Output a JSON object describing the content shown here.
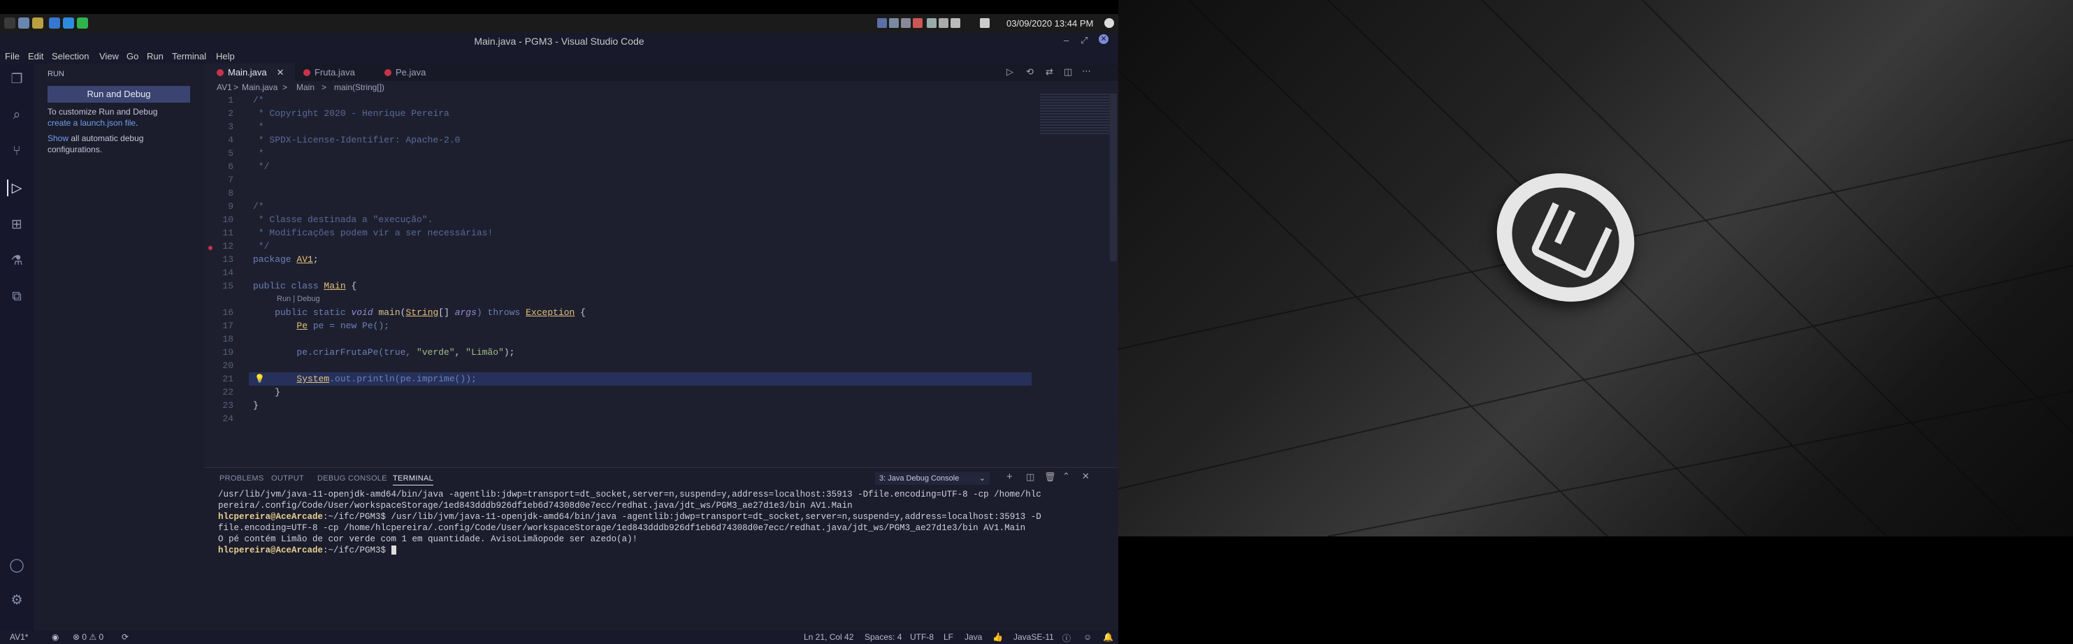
{
  "taskbar": {
    "clock": "03/09/2020 13:44 PM"
  },
  "window": {
    "title": "Main.java - PGM3 - Visual Studio Code"
  },
  "menubar": {
    "items": [
      "File",
      "Edit",
      "Selection",
      "View",
      "Go",
      "Run",
      "Terminal",
      "Help"
    ]
  },
  "sidebar": {
    "header": "RUN",
    "run_button": "Run and Debug",
    "customize_text": "To customize Run and Debug",
    "launch_link": "create a launch.json file",
    "launch_suffix": ".",
    "show_link": "Show",
    "show_text": " all automatic debug",
    "show_text2": "configurations."
  },
  "tabs": [
    {
      "label": "Main.java",
      "active": true
    },
    {
      "label": "Fruta.java",
      "active": false
    },
    {
      "label": "Pe.java",
      "active": false
    }
  ],
  "breadcrumb": {
    "project": "AV1",
    "file": "Main.java",
    "cls": "Main",
    "method": "main(String[])",
    "sep": ">"
  },
  "code": {
    "line_numbers": [
      "1",
      "2",
      "3",
      "4",
      "5",
      "6",
      "7",
      "8",
      "9",
      "10",
      "11",
      "12",
      "13",
      "14",
      "15",
      "",
      "16",
      "17",
      "18",
      "19",
      "20",
      "21",
      "22",
      "23",
      "24"
    ],
    "l1": "/*",
    "l2": " * Copyright 2020 - Henrique Pereira",
    "l3": " *",
    "l4": " * SPDX-License-Identifier: Apache-2.0",
    "l5": " *",
    "l6": " */",
    "l9": "/*",
    "l10": " * Classe destinada a \"execução\".",
    "l11": " * Modificações podem vir a ser necessárias!",
    "l12": " */",
    "l13a": "package ",
    "l13b": "AV1",
    "l13c": ";",
    "l15a": "public class ",
    "l15b": "Main",
    "l15c": " {",
    "codelens": "Run | Debug",
    "l16a": "    public static ",
    "l16b": "void ",
    "l16c": "main",
    "l16d": "(",
    "l16e": "String",
    "l16f": "[] ",
    "l16g": "args",
    "l16h": ") throws ",
    "l16i": "Exception",
    "l16j": " {",
    "l17a": "        ",
    "l17b": "Pe",
    "l17c": " pe = new Pe();",
    "l19a": "        pe.criarFrutaPe(true, ",
    "l19b": "\"verde\"",
    "l19c": ", ",
    "l19d": "\"Limão\"",
    "l19e": ");",
    "l21a": "        ",
    "l21b": "System",
    "l21c": ".out.println(pe.imprime());",
    "l22": "    }",
    "l23": "}"
  },
  "panel": {
    "tabs": [
      "PROBLEMS",
      "OUTPUT",
      "DEBUG CONSOLE",
      "TERMINAL"
    ],
    "dropdown": "3: Java Debug Console",
    "term": {
      "l1": " /usr/lib/jvm/java-11-openjdk-amd64/bin/java -agentlib:jdwp=transport=dt_socket,server=n,suspend=y,address=localhost:35913 -Dfile.encoding=UTF-8 -cp /home/hlc",
      "l2": "pereira/.config/Code/User/workspaceStorage/1ed843dddb926df1eb6d74308d0e7ecc/redhat.java/jdt_ws/PGM3_ae27d1e3/bin AV1.Main",
      "l3p": "hlcpereira@AceArcade",
      "l3a": ":~/ifc/PGM3$  /usr/lib/jvm/java-11-openjdk-amd64/bin/java -agentlib:jdwp=transport=dt_socket,server=n,suspend=y,address=localhost:35913 -D",
      "l4": "file.encoding=UTF-8 -cp /home/hlcpereira/.config/Code/User/workspaceStorage/1ed843dddb926df1eb6d74308d0e7ecc/redhat.java/jdt_ws/PGM3_ae27d1e3/bin AV1.Main",
      "l5": "O pé contém Limão de cor verde com 1 em quantidade. AvisoLimãopode ser azedo(a)!",
      "l6p": "hlcpereira@AceArcade",
      "l6a": ":~/ifc/PGM3$ "
    }
  },
  "statusbar": {
    "branch": "AV1*",
    "problems": "⊗ 0 ⚠ 0",
    "cursor": "Ln 21, Col 42",
    "spaces": "Spaces: 4",
    "encoding": "UTF-8",
    "eol": "LF",
    "language": "Java",
    "jdk": "JavaSE-11"
  },
  "colors": {
    "accent": "#3c4a7a",
    "run_button": "#3b4470",
    "error_dot": "#c7344a"
  }
}
